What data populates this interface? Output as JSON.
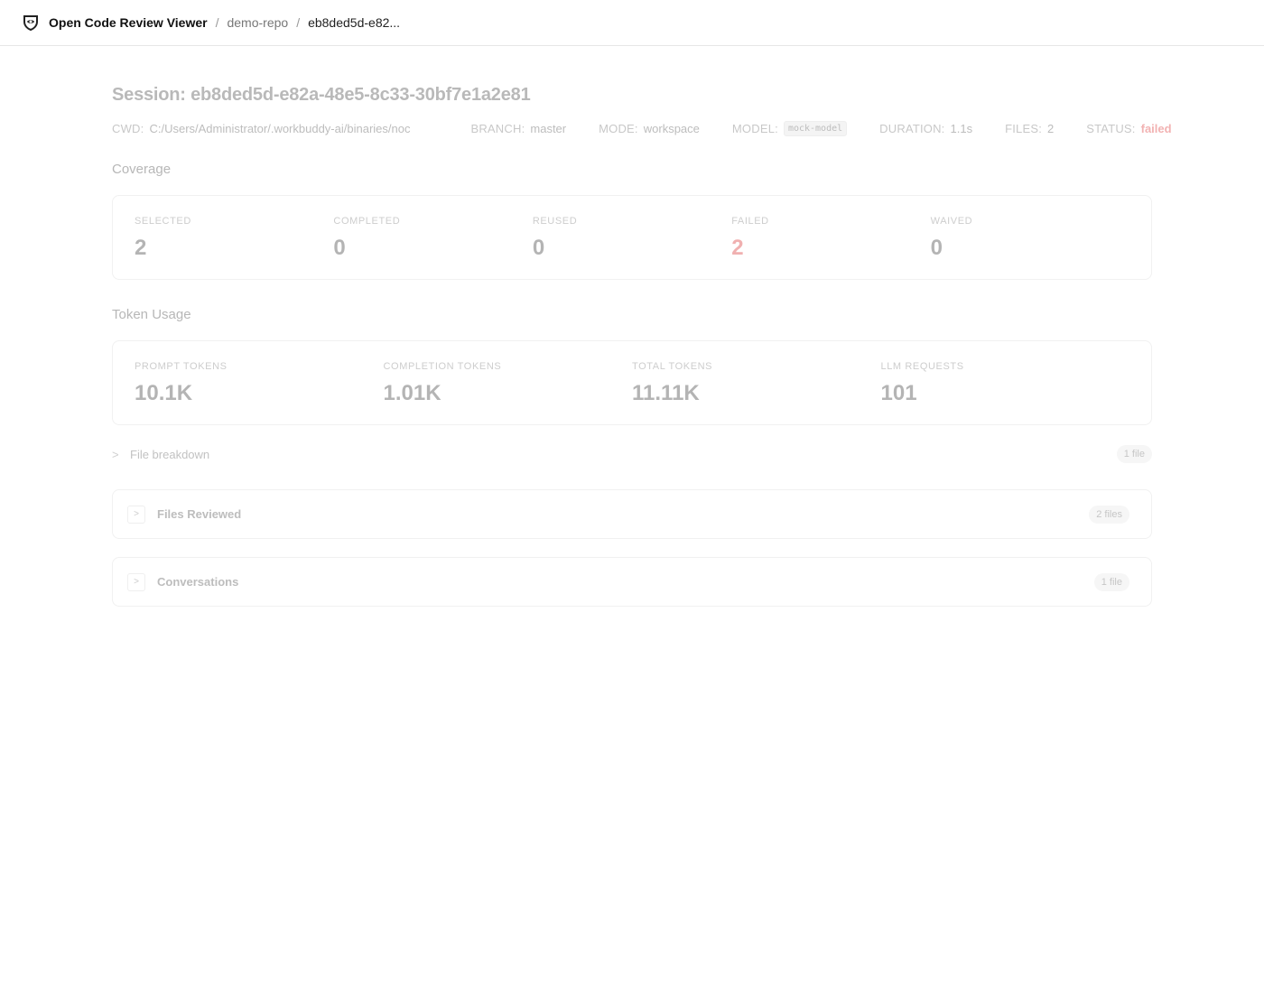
{
  "header": {
    "app_title": "Open Code Review Viewer",
    "crumb_repo": "demo-repo",
    "crumb_session": "eb8ded5d-e82...",
    "separator": "/",
    "logo_icon": "shield-eye-icon"
  },
  "session": {
    "title": "Session: eb8ded5d-e82a-48e5-8c33-30bf7e1a2e81",
    "meta": {
      "cwd_label": "CWD:",
      "cwd_value": "C:/Users/Administrator/.workbuddy-ai/binaries/noc",
      "branch_label": "BRANCH:",
      "branch_value": "master",
      "mode_label": "MODE:",
      "mode_value": "workspace",
      "model_label": "MODEL:",
      "model_value": "mock-model",
      "duration_label": "DURATION:",
      "duration_value": "1.1s",
      "files_label": "FILES:",
      "files_value": "2",
      "status_label": "STATUS:",
      "status_value": "failed"
    }
  },
  "coverage": {
    "title": "Coverage",
    "stats": [
      {
        "label": "SELECTED",
        "value": "2"
      },
      {
        "label": "COMPLETED",
        "value": "0"
      },
      {
        "label": "REUSED",
        "value": "0"
      },
      {
        "label": "FAILED",
        "value": "2"
      },
      {
        "label": "WAIVED",
        "value": "0"
      }
    ]
  },
  "tokens": {
    "title": "Token Usage",
    "stats": [
      {
        "label": "PROMPT TOKENS",
        "value": "10.1K"
      },
      {
        "label": "COMPLETION TOKENS",
        "value": "1.01K"
      },
      {
        "label": "TOTAL TOKENS",
        "value": "11.11K"
      },
      {
        "label": "LLM REQUESTS",
        "value": "101"
      }
    ]
  },
  "breakdown": {
    "label": "File breakdown",
    "badge": "1 file",
    "chevron": ">"
  },
  "panels": [
    {
      "title": "Files Reviewed",
      "badge": "2 files",
      "chevron": ">"
    },
    {
      "title": "Conversations",
      "badge": "1 file",
      "chevron": ">"
    }
  ],
  "colors": {
    "failed": "#f0b0b0",
    "border": "#e6e6e6"
  }
}
